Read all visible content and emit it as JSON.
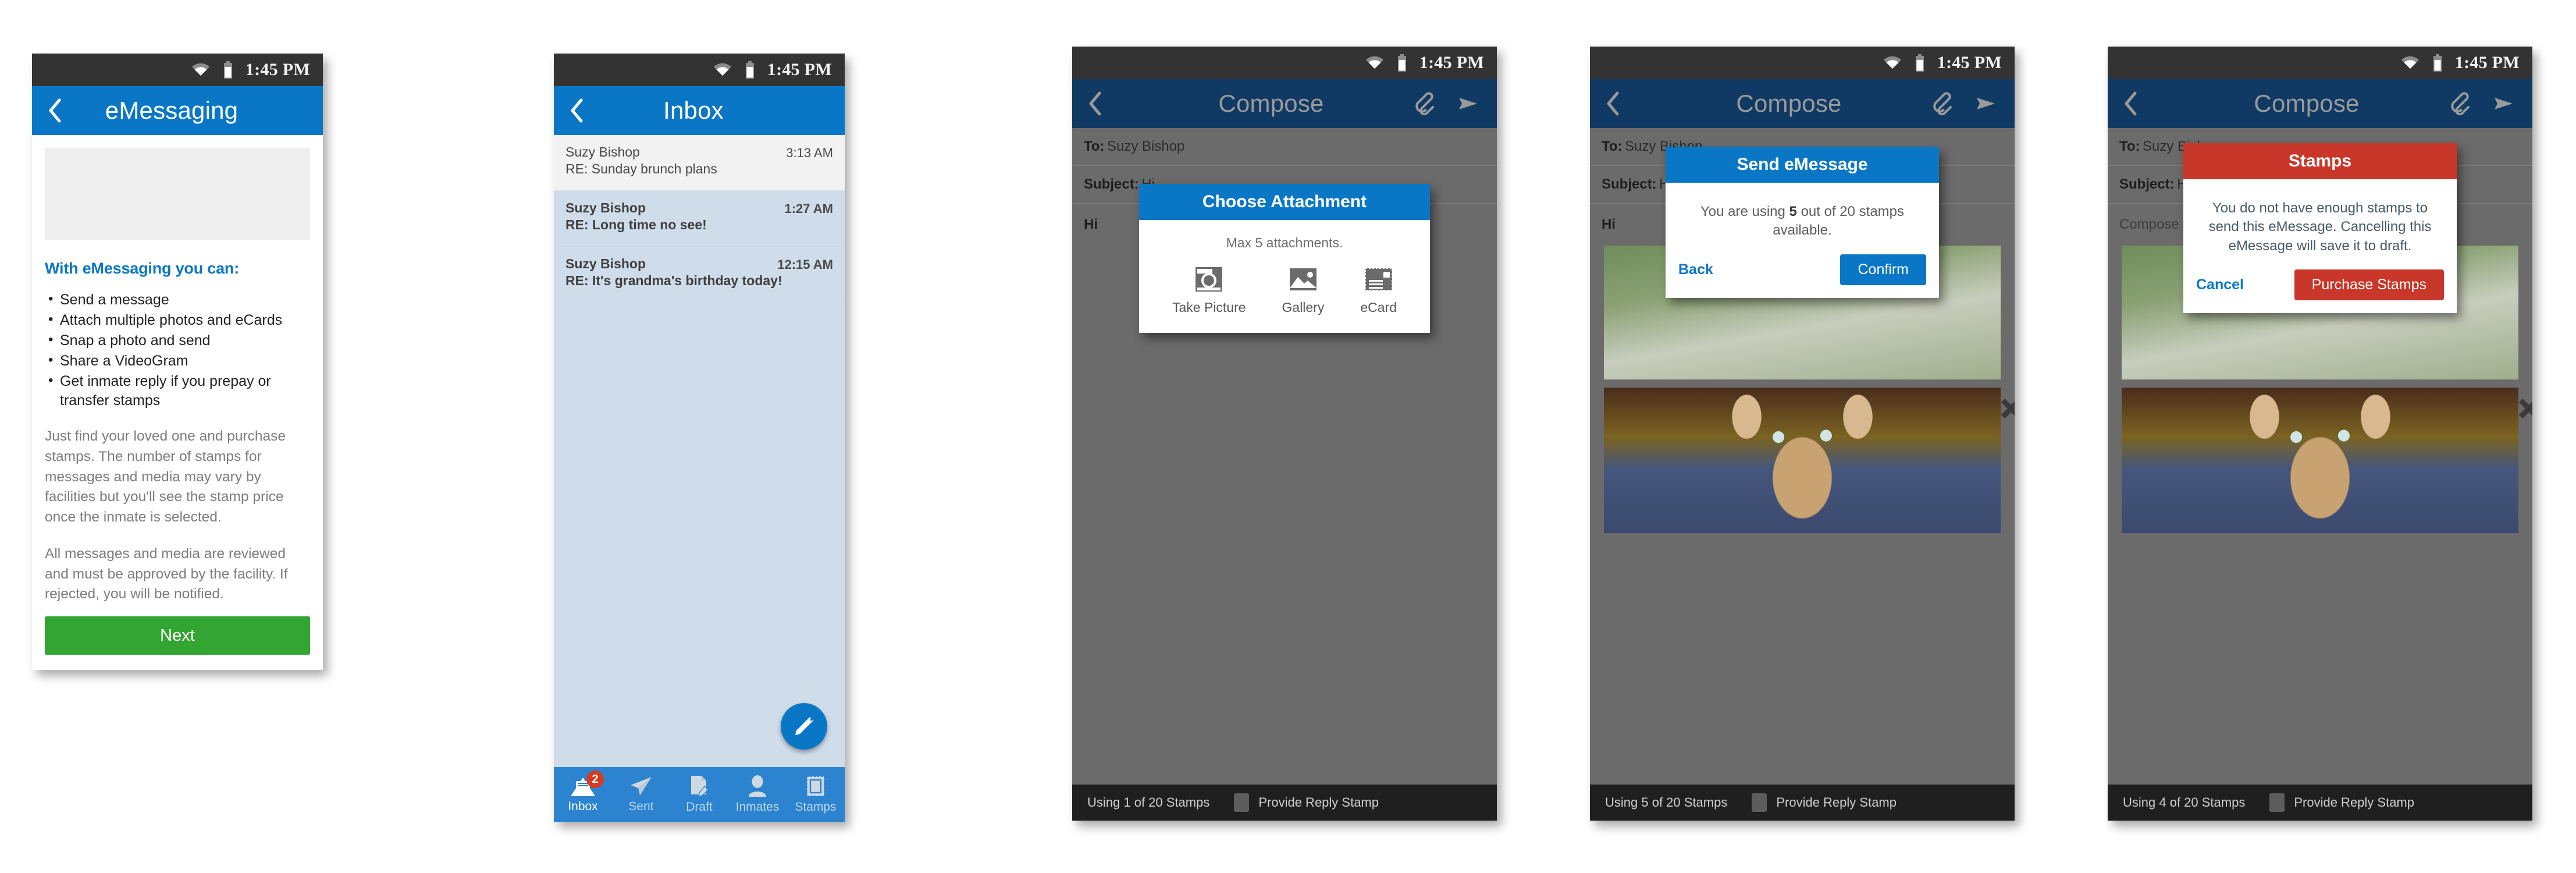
{
  "status_bar": {
    "time": "1:45 PM",
    "wifi_icon": "wifi-icon",
    "battery_icon": "battery-icon"
  },
  "panel1": {
    "title": "eMessaging",
    "back_icon": "back-chevron-icon",
    "heading": "With eMessaging you can:",
    "features": [
      "Send a message",
      "Attach multiple photos and eCards",
      "Snap a photo and send",
      "Share a VideoGram",
      "Get inmate reply if you prepay or transfer stamps"
    ],
    "paragraph1": "Just find your loved one and purchase stamps. The number of stamps for messages and media may vary by facilities but you'll see the stamp price once the inmate is selected.",
    "paragraph2": "All messages and media are reviewed and must be approved by the facility. If rejected, you will be notified.",
    "next_label": "Next",
    "accent_blue": "#0a77c6",
    "next_green": "#33a532"
  },
  "panel2": {
    "title": "Inbox",
    "back_icon": "back-chevron-icon",
    "messages": [
      {
        "from": "Suzy Bishop",
        "subject": "RE:  Sunday brunch plans",
        "time": "3:13 AM",
        "state": "read"
      },
      {
        "from": "Suzy Bishop",
        "subject": "RE: Long time no see!",
        "time": "1:27 AM",
        "state": "unread"
      },
      {
        "from": "Suzy Bishop",
        "subject": "RE: It's grandma's birthday today!",
        "time": "12:15 AM",
        "state": "unread"
      }
    ],
    "compose_fab_icon": "pencil-icon",
    "tabs": [
      {
        "label": "Inbox",
        "icon": "envelope-icon",
        "badge": "2",
        "active": true
      },
      {
        "label": "Sent",
        "icon": "paper-plane-icon",
        "badge": "",
        "active": false
      },
      {
        "label": "Draft",
        "icon": "document-pencil-icon",
        "badge": "",
        "active": false
      },
      {
        "label": "Inmates",
        "icon": "person-icon",
        "badge": "",
        "active": false
      },
      {
        "label": "Stamps",
        "icon": "stamp-icon",
        "badge": "",
        "active": false
      }
    ]
  },
  "panel3": {
    "title": "Compose",
    "back_icon": "back-chevron-icon",
    "attach_icon": "paperclip-icon",
    "send_icon": "send-icon",
    "to_label": "To:",
    "to_value": "Suzy Bishop",
    "subject_label": "Subject:",
    "subject_value": "Hi",
    "body_value": "Hi",
    "stamp_status": "Using 1 of 20 Stamps",
    "reply_stamp_label": "Provide Reply Stamp",
    "dialog": {
      "title": "Choose Attachment",
      "subtitle": "Max 5 attachments.",
      "options": [
        {
          "label": "Take Picture",
          "icon": "camera-icon"
        },
        {
          "label": "Gallery",
          "icon": "image-icon"
        },
        {
          "label": "eCard",
          "icon": "postcard-stamp-icon"
        }
      ]
    }
  },
  "panel4": {
    "title": "Compose",
    "back_icon": "back-chevron-icon",
    "attach_icon": "paperclip-icon",
    "send_icon": "send-icon",
    "to_label": "To:",
    "to_value": "Suzy Bishop",
    "subject_label": "Subject:",
    "subject_value": "Hi",
    "body_value": "Hi",
    "stamp_status": "Using 5 of 20 Stamps",
    "reply_stamp_label": "Provide Reply Stamp",
    "attachments": [
      {
        "name": "flower-photo",
        "remove_icon": "close-x-icon"
      },
      {
        "name": "kitten-photo",
        "remove_icon": "close-x-icon"
      }
    ],
    "dialog": {
      "title": "Send eMessage",
      "message_pre": "You are using ",
      "message_count": "5",
      "message_post": " out of 20 stamps available.",
      "back_label": "Back",
      "confirm_label": "Confirm"
    }
  },
  "panel5": {
    "title": "Compose",
    "back_icon": "back-chevron-icon",
    "attach_icon": "paperclip-icon",
    "send_icon": "send-icon",
    "to_label": "To:",
    "to_value": "Suzy Bishop",
    "subject_label": "Subject:",
    "subject_value": "Hi",
    "body_value": "Compose",
    "stamp_status": "Using 4 of 20 Stamps",
    "reply_stamp_label": "Provide Reply Stamp",
    "attachments": [
      {
        "name": "flower-photo",
        "remove_icon": "close-x-icon"
      },
      {
        "name": "kitten-photo",
        "remove_icon": "close-x-icon"
      }
    ],
    "dialog": {
      "title": "Stamps",
      "message": "You do not have enough stamps to send this eMessage. Cancelling this eMessage will save it to draft.",
      "cancel_label": "Cancel",
      "purchase_label": "Purchase Stamps",
      "accent_red": "#c9372a"
    }
  }
}
